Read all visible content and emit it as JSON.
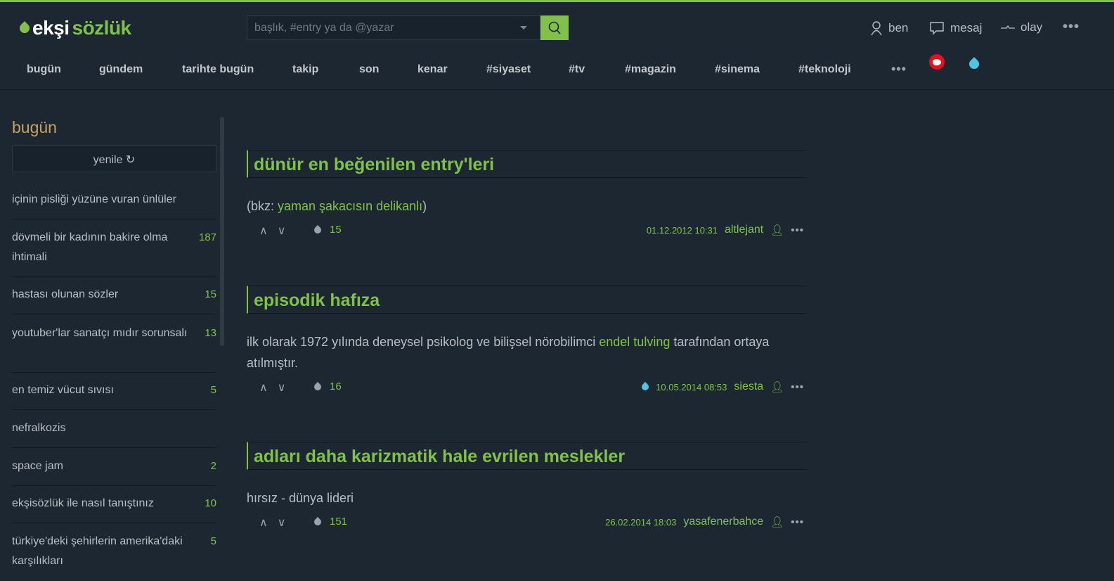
{
  "logo": {
    "part1": "ekşi",
    "part2": "sözlük"
  },
  "search": {
    "placeholder": "başlık, #entry ya da @yazar"
  },
  "user_menu": [
    {
      "label": "ben",
      "icon": "user-icon"
    },
    {
      "label": "mesaj",
      "icon": "message-icon"
    },
    {
      "label": "olay",
      "icon": "activity-icon"
    }
  ],
  "nav": [
    "bugün",
    "gündem",
    "tarihte bugün",
    "takip",
    "son",
    "kenar",
    "#siyaset",
    "#tv",
    "#magazin",
    "#sinema",
    "#teknoloji"
  ],
  "sidebar": {
    "title": "bugün",
    "refresh": "yenile ↻",
    "items": [
      {
        "title": "içinin pisliği yüzüne vuran ünlüler",
        "count": ""
      },
      {
        "title": "dövmeli bir kadının bakire olma ihtimali",
        "count": "187"
      },
      {
        "title": "hastası olunan sözler",
        "count": "15"
      },
      {
        "title": "youtuber'lar sanatçı mıdır sorunsalı",
        "count": "13"
      },
      {
        "title": "en temiz vücut sıvısı",
        "count": "5"
      },
      {
        "title": "nefralkozis",
        "count": ""
      },
      {
        "title": "space jam",
        "count": "2"
      },
      {
        "title": "ekşisözlük ile nasıl tanıştınız",
        "count": "10"
      },
      {
        "title": "türkiye'deki şehirlerin amerika'daki karşılıkları",
        "count": "5"
      }
    ]
  },
  "entries": [
    {
      "title": "dünür en beğenilen entry'leri",
      "pre": "(bkz: ",
      "link": "yaman şakacısın delikanlı",
      "post": ")",
      "fav": "15",
      "date": "01.12.2012 10:31",
      "author": "altlejant"
    },
    {
      "title": "episodik hafıza",
      "pre": "ilk olarak 1972 yılında deneysel psikolog ve bilişsel nörobilimci ",
      "link": "endel tulving",
      "post": " tarafından ortaya atılmıştır.",
      "fav": "16",
      "date": "10.05.2014 08:53",
      "author": "siesta"
    },
    {
      "title": "adları daha karizmatik hale evrilen meslekler",
      "pre": "hırsız - dünya lideri",
      "link": "",
      "post": "",
      "fav": "151",
      "date": "26.02.2014 18:03",
      "author": "yasafenerbahce"
    }
  ],
  "colors": {
    "accent": "#81c14b",
    "bg": "#1c2732"
  }
}
